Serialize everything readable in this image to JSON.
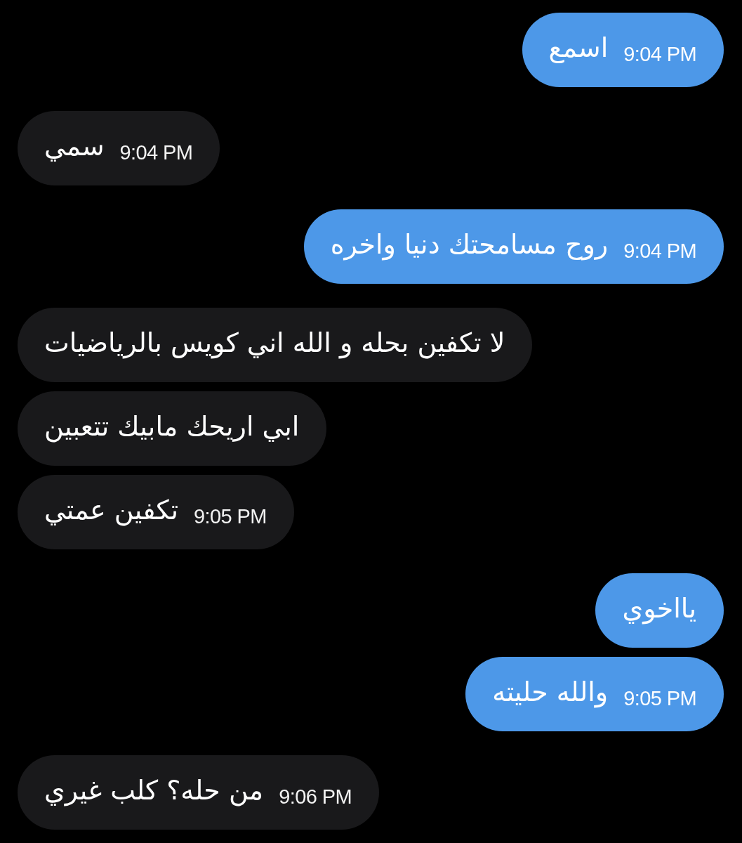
{
  "messages": [
    {
      "outgoing": true,
      "text": "اسمع",
      "time": "9:04 PM"
    },
    {
      "outgoing": false,
      "text": "سمي",
      "time": "9:04 PM"
    },
    {
      "outgoing": true,
      "text": "روح مسامحتك دنيا واخره",
      "time": "9:04 PM"
    },
    {
      "outgoing": false,
      "text": "لا تكفين بحله و الله اني كويس بالرياضيات"
    },
    {
      "outgoing": false,
      "text": "ابي اريحك مابيك تتعبين"
    },
    {
      "outgoing": false,
      "text": "تكفين عمتي",
      "time": "9:05 PM"
    },
    {
      "outgoing": true,
      "text": "يااخوي"
    },
    {
      "outgoing": true,
      "text": "والله حليته",
      "time": "9:05 PM"
    },
    {
      "outgoing": false,
      "text": "من حله؟ كلب غيري",
      "time": "9:06 PM"
    }
  ]
}
